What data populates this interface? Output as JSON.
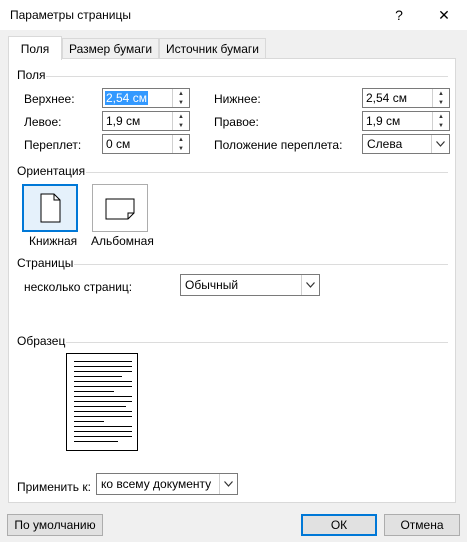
{
  "window": {
    "title": "Параметры страницы",
    "help": "?",
    "close": "✕"
  },
  "tabs": [
    "Поля",
    "Размер бумаги",
    "Источник бумаги"
  ],
  "margins": {
    "section": "Поля",
    "top_label": "Верхнее:",
    "top_value": "2,54 см",
    "bottom_label": "Нижнее:",
    "bottom_value": "2,54 см",
    "left_label": "Левое:",
    "left_value": "1,9 см",
    "right_label": "Правое:",
    "right_value": "1,9 см",
    "gutter_label": "Переплет:",
    "gutter_value": "0 см",
    "gutter_pos_label": "Положение переплета:",
    "gutter_pos_value": "Слева"
  },
  "orientation": {
    "section": "Ориентация",
    "portrait": "Книжная",
    "landscape": "Альбомная",
    "selected": "portrait"
  },
  "pages": {
    "section": "Страницы",
    "multiple_label": "несколько страниц:",
    "multiple_value": "Обычный"
  },
  "preview": {
    "section": "Образец"
  },
  "apply": {
    "label": "Применить к:",
    "value": "ко всему документу"
  },
  "buttons": {
    "default": "По умолчанию",
    "ok": "ОК",
    "cancel": "Отмена"
  }
}
